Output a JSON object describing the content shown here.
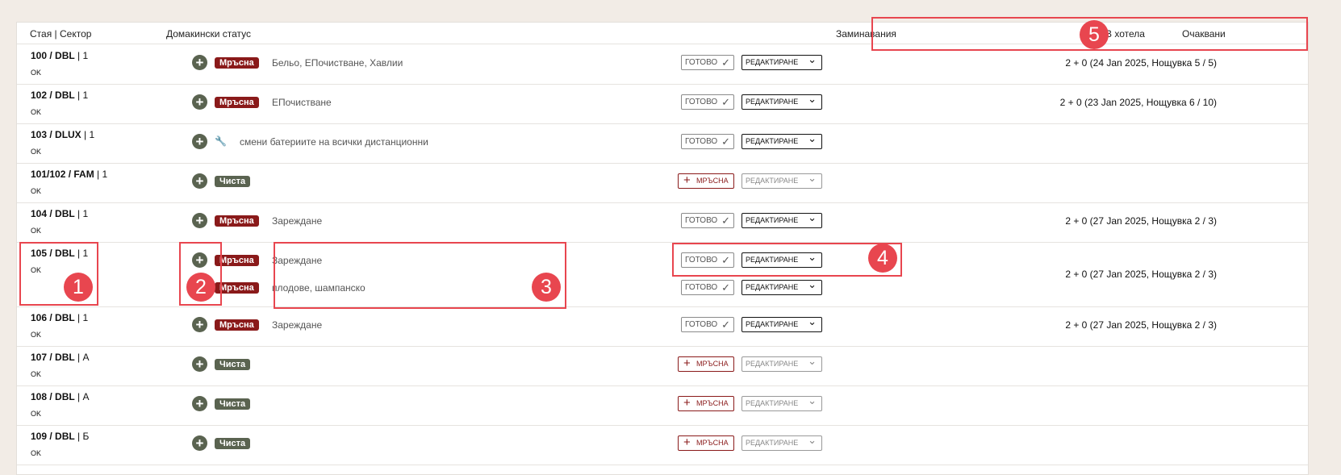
{
  "header": {
    "room_sector": "Стая | Сектор",
    "housekeeping_status": "Домакински статус",
    "departures": "Заминавания",
    "in_hotel": "В хотела",
    "expected": "Очаквани"
  },
  "buttons": {
    "ready": "ГОТОВО",
    "dirty": "МРЪСНА",
    "edit": "РЕДАКТИРАНЕ"
  },
  "status_labels": {
    "dirty": "Мръсна",
    "clean": "Чиста"
  },
  "rows": [
    {
      "room": "100 / DBL",
      "sector": " | 1",
      "ok": "OK",
      "tasks": [
        {
          "status": "Мръсна",
          "desc": "Бельо, ЕПочистване, Хавлии"
        }
      ],
      "checkout": "2 + 0 (24 Jan 2025, Нощувка 5 / 5)"
    },
    {
      "room": "102 / DBL",
      "sector": " | 1",
      "ok": "OK",
      "tasks": [
        {
          "status": "Мръсна",
          "desc": "ЕПочистване"
        }
      ],
      "checkout": "2 + 0 (23 Jan 2025, Нощувка 6 / 10)"
    },
    {
      "room": "103 / DLUX",
      "sector": " | 1",
      "ok": "OK",
      "tasks": [
        {
          "status": "",
          "desc": "смени батериите на всички дистанционни"
        }
      ],
      "checkout": ""
    },
    {
      "room": "101/102 / FAM",
      "sector": " | 1",
      "ok": "OK",
      "tasks": [
        {
          "status": "Чиста",
          "desc": ""
        }
      ],
      "checkout": ""
    },
    {
      "room": "104 / DBL",
      "sector": " | 1",
      "ok": "OK",
      "tasks": [
        {
          "status": "Мръсна",
          "desc": "Зареждане"
        }
      ],
      "checkout": "2 + 0 (27 Jan 2025, Нощувка 2 / 3)"
    },
    {
      "room": "105 / DBL",
      "sector": " | 1",
      "ok": "OK",
      "tasks": [
        {
          "status": "Мръсна",
          "desc": "Зареждане"
        },
        {
          "status": "Мръсна",
          "desc": "плодове, шампанско"
        }
      ],
      "checkout": "2 + 0 (27 Jan 2025, Нощувка 2 / 3)"
    },
    {
      "room": "106 / DBL",
      "sector": " | 1",
      "ok": "OK",
      "tasks": [
        {
          "status": "Мръсна",
          "desc": "Зареждане"
        }
      ],
      "checkout": "2 + 0 (27 Jan 2025, Нощувка 2 / 3)"
    },
    {
      "room": "107 / DBL",
      "sector": " | А",
      "ok": "OK",
      "tasks": [
        {
          "status": "Чиста",
          "desc": ""
        }
      ],
      "checkout": ""
    },
    {
      "room": "108 / DBL",
      "sector": " | А",
      "ok": "OK",
      "tasks": [
        {
          "status": "Чиста",
          "desc": ""
        }
      ],
      "checkout": ""
    },
    {
      "room": "109 / DBL",
      "sector": " | Б",
      "ok": "OK",
      "tasks": [
        {
          "status": "Чиста",
          "desc": ""
        }
      ],
      "checkout": ""
    }
  ],
  "annotations": [
    "1",
    "2",
    "3",
    "4",
    "5"
  ],
  "colors": {
    "accent_red": "#e8464f",
    "dirty": "#8a1a1a",
    "clean": "#5a6350",
    "background": "#f2ece6"
  },
  "icons": {
    "add": "plus-circle-icon",
    "maintenance": "wrench-icon",
    "ready": "check-icon",
    "dropdown": "chevron-down-icon"
  }
}
